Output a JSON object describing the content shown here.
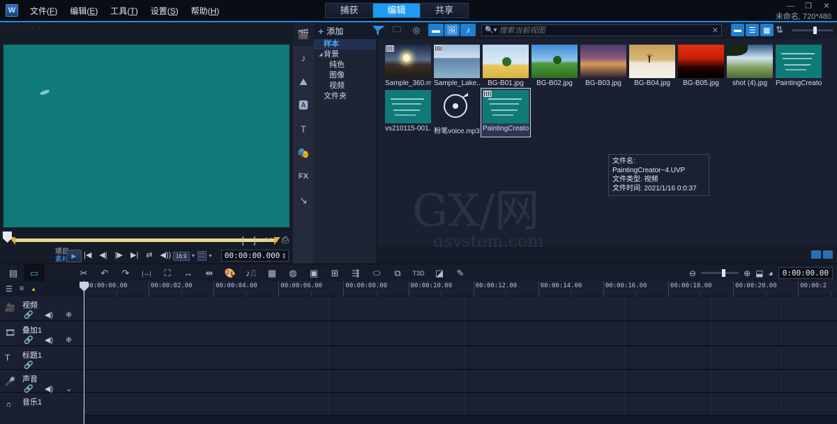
{
  "titlebar": {
    "logo": "W",
    "menus": [
      {
        "label": "文件(F)"
      },
      {
        "label": "编辑(E)"
      },
      {
        "label": "工具(T)"
      },
      {
        "label": "设置(S)"
      },
      {
        "label": "帮助(H)"
      }
    ],
    "window_controls": [
      {
        "name": "minimize-button",
        "glyph": "—"
      },
      {
        "name": "restore-button",
        "glyph": "❐"
      },
      {
        "name": "close-button",
        "glyph": "✕"
      }
    ],
    "project_info": "未命名, 720*480",
    "tabs": [
      {
        "label": "捕获",
        "active": false
      },
      {
        "label": "编辑",
        "active": true
      },
      {
        "label": "共享",
        "active": false
      }
    ],
    "accent_color": "#1d9bf0"
  },
  "preview": {
    "screen_color": "#0f7a77",
    "timecode": "00:00:00.000",
    "aspect_ratio": "16:9",
    "source_toggle": {
      "project": "项目－",
      "clip": "素材－"
    },
    "mark_buttons": [
      {
        "name": "mark-in-button",
        "glyph": "["
      },
      {
        "name": "mark-out-button",
        "glyph": "]"
      },
      {
        "name": "split-clip-button",
        "glyph": "✂"
      },
      {
        "name": "snapshot-button",
        "glyph": "⎙"
      }
    ],
    "playback_buttons": [
      {
        "name": "play-button",
        "glyph": "▶"
      },
      {
        "name": "home-button",
        "glyph": "|◀"
      },
      {
        "name": "prev-frame-button",
        "glyph": "◀|"
      },
      {
        "name": "next-frame-button",
        "glyph": "|▶"
      },
      {
        "name": "end-button",
        "glyph": "▶|"
      },
      {
        "name": "repeat-button",
        "glyph": "⇄"
      },
      {
        "name": "volume-button",
        "glyph": "◀))"
      }
    ]
  },
  "library": {
    "add_label": "添加",
    "browse_label": "浏览",
    "search_placeholder": "搜索当前视图",
    "search_value": "",
    "rail": [
      {
        "name": "media-icon",
        "active": true
      },
      {
        "name": "audio-icon",
        "active": false
      },
      {
        "name": "transition-icon",
        "active": false
      },
      {
        "name": "title-template-icon",
        "active": false
      },
      {
        "name": "title-icon",
        "active": false
      },
      {
        "name": "graphic-icon",
        "active": false
      },
      {
        "name": "fx-icon",
        "active": false,
        "label": "FX"
      },
      {
        "name": "path-icon",
        "active": false
      }
    ],
    "tree": [
      {
        "label": "样本",
        "indent": 0,
        "selected": true,
        "caret": false
      },
      {
        "label": "背景",
        "indent": 0,
        "selected": false,
        "caret": true
      },
      {
        "label": "纯色",
        "indent": 1,
        "selected": false,
        "caret": false
      },
      {
        "label": "图像",
        "indent": 1,
        "selected": false,
        "caret": false
      },
      {
        "label": "视频",
        "indent": 1,
        "selected": false,
        "caret": false
      },
      {
        "label": "文件夹",
        "indent": 0,
        "selected": false,
        "caret": false
      }
    ],
    "filter_buttons": [
      {
        "name": "filter-video-icon",
        "glyph": "▬",
        "active": true
      },
      {
        "name": "filter-photo-icon",
        "glyph": "🖼",
        "active": true
      },
      {
        "name": "filter-audio-icon",
        "glyph": "♪",
        "active": true
      }
    ],
    "view_modes": [
      {
        "name": "view-thumbnail-button",
        "glyph": "▬"
      },
      {
        "name": "view-list-button",
        "glyph": "☰"
      },
      {
        "name": "view-grid-button",
        "glyph": "▦"
      }
    ],
    "media": [
      {
        "caption": "Sample_360.m...",
        "type": "video",
        "thumb": "sunset-rock"
      },
      {
        "caption": "Sample_Lake...",
        "type": "video",
        "thumb": "lake"
      },
      {
        "caption": "BG-B01.jpg",
        "type": "image",
        "thumb": "tree-yellow"
      },
      {
        "caption": "BG-B02.jpg",
        "type": "image",
        "thumb": "tree-green"
      },
      {
        "caption": "BG-B03.jpg",
        "type": "image",
        "thumb": "sunset-purple"
      },
      {
        "caption": "BG-B04.jpg",
        "type": "image",
        "thumb": "desert"
      },
      {
        "caption": "BG-B05.jpg",
        "type": "image",
        "thumb": "red-sky"
      },
      {
        "caption": "shot (4).jpg",
        "type": "image",
        "thumb": "clouds"
      },
      {
        "caption": "PaintingCreato...",
        "type": "image",
        "thumb": "chalkboard"
      },
      {
        "caption": "vs210115-001...",
        "type": "image",
        "thumb": "chalkboard"
      },
      {
        "caption": "粉笔voice.mp3",
        "type": "audio",
        "thumb": "disc"
      },
      {
        "caption": "PaintingCreato...",
        "type": "video",
        "thumb": "chalkboard",
        "selected": true
      }
    ],
    "tooltip": {
      "filename": "文件名: PaintingCreator~4.UVP",
      "filetype": "文件类型: 视频",
      "filetime": "文件时间: 2021/1/16 0:0:37"
    },
    "watermark": {
      "main": "GX/网",
      "sub": "gsystem.com"
    }
  },
  "timeline": {
    "toolbar_left": [
      {
        "name": "storyboard-view-button",
        "glyph": "▤",
        "active": false
      },
      {
        "name": "timeline-view-button",
        "glyph": "▭",
        "active": true
      }
    ],
    "toolbar_tools": [
      {
        "name": "mix-tool-icon",
        "glyph": "✂"
      },
      {
        "name": "undo-icon",
        "glyph": "↶"
      },
      {
        "name": "redo-icon",
        "glyph": "↷"
      },
      {
        "name": "fit-project-icon",
        "glyph": "|↔|"
      },
      {
        "name": "crop-icon",
        "glyph": "⛶"
      },
      {
        "name": "trim-icon",
        "glyph": "↔"
      },
      {
        "name": "extend-icon",
        "glyph": "⇹"
      },
      {
        "name": "color-icon",
        "glyph": "🎨"
      },
      {
        "name": "audio-mixer-icon",
        "glyph": "♪⎍"
      },
      {
        "name": "motion-track-icon",
        "glyph": "▦"
      },
      {
        "name": "multicam-icon",
        "glyph": "◍"
      },
      {
        "name": "subtitle-icon",
        "glyph": "▣"
      },
      {
        "name": "storyboard-grid-icon",
        "glyph": "⊞"
      },
      {
        "name": "speed-icon",
        "glyph": "⇶"
      },
      {
        "name": "mask-icon",
        "glyph": "⬭"
      },
      {
        "name": "tracker-icon",
        "glyph": "⧉"
      },
      {
        "name": "title-3d-icon",
        "glyph": "T3D"
      },
      {
        "name": "chroma-icon",
        "glyph": "◪"
      },
      {
        "name": "edit-icon",
        "glyph": "✎"
      }
    ],
    "zoom_controls": [
      {
        "name": "zoom-out-icon",
        "glyph": "⊖"
      },
      {
        "name": "zoom-in-icon",
        "glyph": "⊕"
      },
      {
        "name": "fit-timeline-icon",
        "glyph": "⬓"
      },
      {
        "name": "timecode-mode-icon",
        "glyph": "◕"
      }
    ],
    "timecode": "0:00:00.00",
    "head_tools": [
      {
        "name": "track-manager-icon",
        "glyph": "☰"
      },
      {
        "name": "track-list-icon",
        "glyph": "≡"
      },
      {
        "name": "keyframe-icon",
        "glyph": "▲"
      }
    ],
    "ruler_ticks": [
      "00:00:00.00",
      "00:00:02.00",
      "00:00:04.00",
      "00:00:06.00",
      "00:00:08.00",
      "00:00:10.00",
      "00:00:12.00",
      "00:00:14.00",
      "00:00:16.00",
      "00:00:18.00",
      "00:00:20.00",
      "00:00:2"
    ],
    "tracks": [
      {
        "name": "视频",
        "icon": "video-track-icon",
        "height": 35,
        "buttons": [
          "link",
          "volume",
          "mute-fx"
        ]
      },
      {
        "name": "叠加1",
        "icon": "overlay-track-icon",
        "height": 35,
        "buttons": [
          "link",
          "volume",
          "mute-fx"
        ]
      },
      {
        "name": "标题1",
        "icon": "title-track-icon",
        "height": 33,
        "buttons": [
          "link"
        ]
      },
      {
        "name": "声音",
        "icon": "voice-track-icon",
        "height": 32,
        "buttons": [
          "link",
          "volume",
          "chevron"
        ]
      },
      {
        "name": "音乐1",
        "icon": "music-track-icon",
        "height": 32,
        "buttons": [
          "link",
          "volume",
          "chevron"
        ]
      }
    ]
  }
}
